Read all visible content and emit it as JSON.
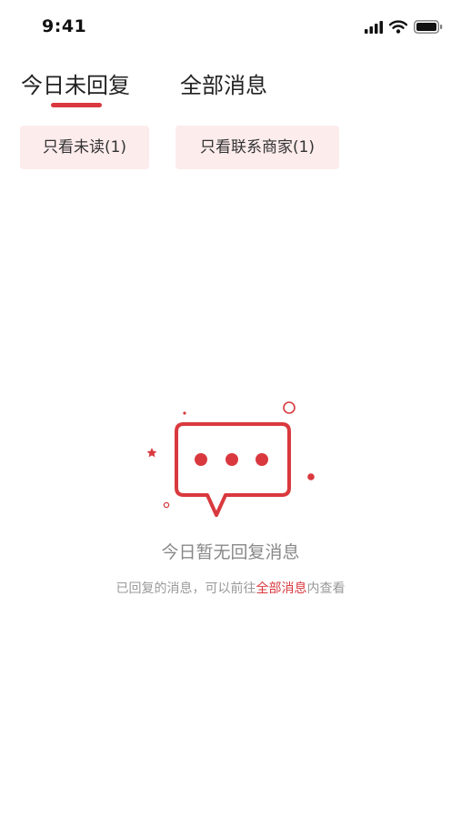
{
  "status_bar": {
    "time": "9:41"
  },
  "tabs": [
    {
      "label": "今日未回复",
      "active": true
    },
    {
      "label": "全部消息",
      "active": false
    }
  ],
  "filters": [
    {
      "label": "只看未读(1)"
    },
    {
      "label": "只看联系商家(1)"
    }
  ],
  "empty_state": {
    "title": "今日暂无回复消息",
    "description_prefix": "已回复的消息，可以前往",
    "description_link": "全部消息",
    "description_suffix": "内查看"
  },
  "colors": {
    "accent": "#d9393e",
    "chip_background": "#fdecec",
    "muted_text": "#999999"
  }
}
